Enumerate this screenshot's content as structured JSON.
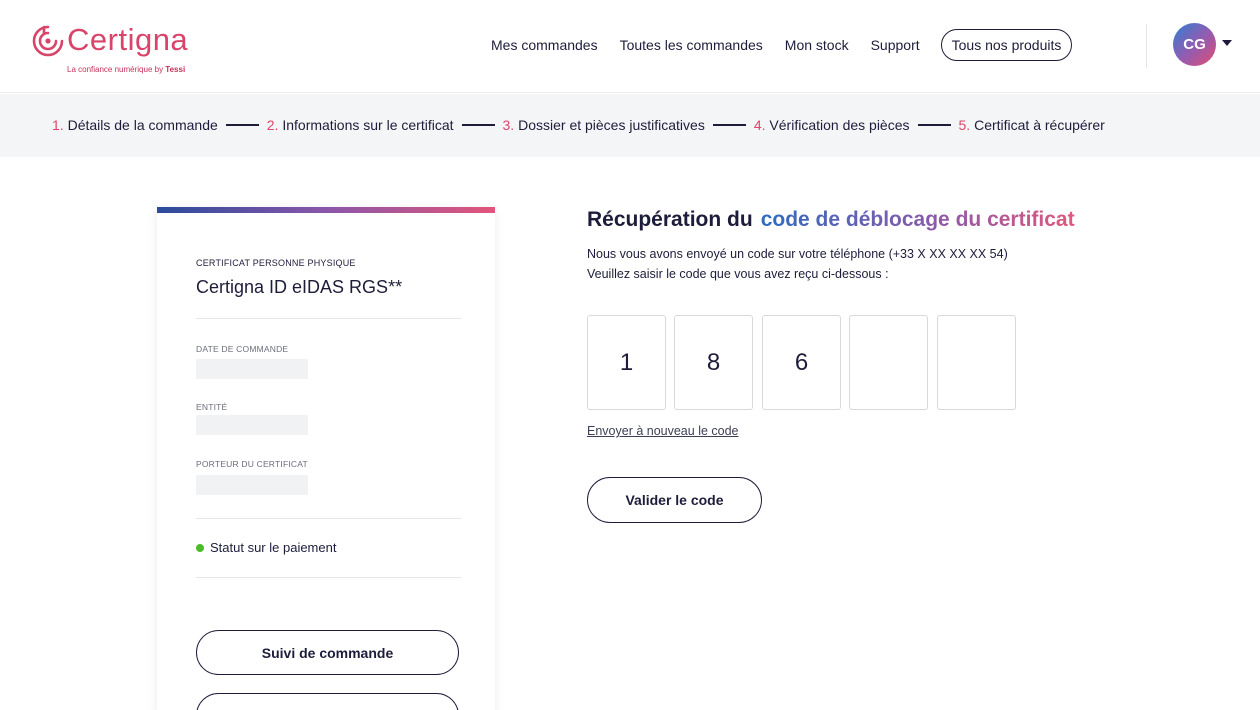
{
  "header": {
    "logo": {
      "name": "Certigna",
      "tagline_prefix": "La confiance numérique by",
      "tagline_brand": "Tessi"
    },
    "nav": [
      {
        "label": "Mes commandes"
      },
      {
        "label": "Toutes les commandes"
      },
      {
        "label": "Mon stock"
      },
      {
        "label": "Support"
      }
    ],
    "products_button": "Tous nos produits",
    "avatar_initials": "CG"
  },
  "stepper": [
    {
      "num": "1.",
      "label": "Détails de la commande"
    },
    {
      "num": "2.",
      "label": "Informations sur le certificat"
    },
    {
      "num": "3.",
      "label": "Dossier et pièces justificatives"
    },
    {
      "num": "4.",
      "label": "Vérification des pièces"
    },
    {
      "num": "5.",
      "label": "Certificat à récupérer"
    }
  ],
  "card": {
    "eyebrow": "CERTIFICAT PERSONNE PHYSIQUE",
    "title": "Certigna ID eIDAS RGS**",
    "fields": [
      {
        "label": "DATE DE COMMANDE",
        "value": ""
      },
      {
        "label": "ENTITÉ",
        "value": ""
      },
      {
        "label": "PORTEUR DU CERTIFICAT",
        "value": ""
      }
    ],
    "status": "Statut sur le paiement",
    "buttons": {
      "track": "Suivi de commande",
      "second": ""
    }
  },
  "main": {
    "title_plain": "Récupération du",
    "title_highlight": "code de déblocage du certificat",
    "line1": "Nous vous avons envoyé un code sur votre téléphone (+33 X XX XX XX 54)",
    "line2": "Veuillez saisir le code que vous avez reçu ci-dessous :",
    "code_digits": [
      "1",
      "8",
      "6",
      "",
      ""
    ],
    "resend": "Envoyer à nouveau le code",
    "validate": "Valider le code"
  },
  "colors": {
    "brand_pink": "#e0456b",
    "text_dark": "#1d1d3b",
    "status_green": "#4cbb2b"
  }
}
